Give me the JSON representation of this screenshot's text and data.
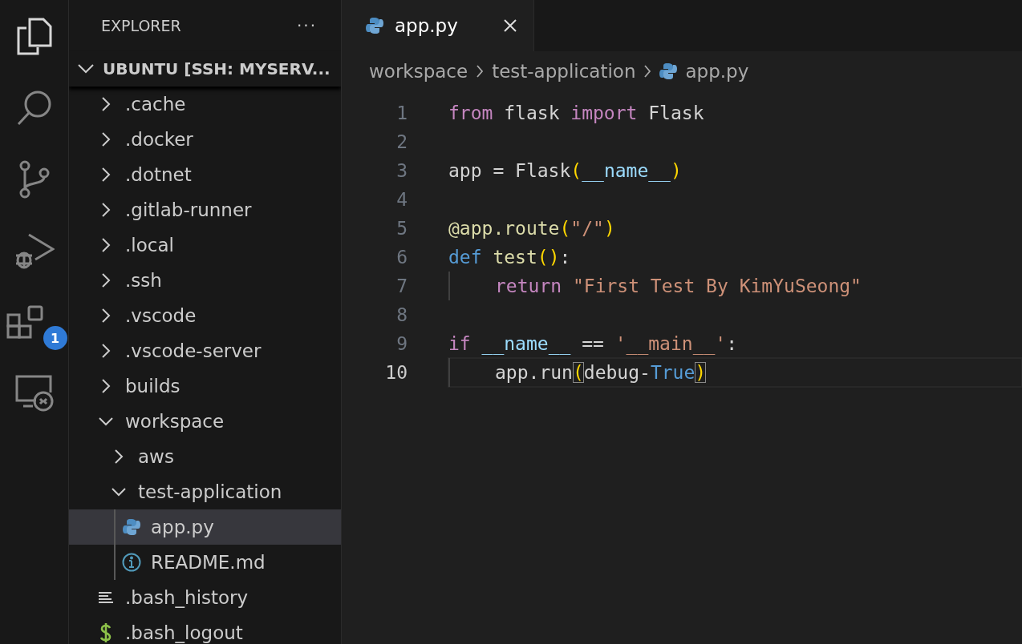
{
  "activity_bar": [
    {
      "kind": "files",
      "selected": true
    },
    {
      "kind": "search",
      "selected": false
    },
    {
      "kind": "source-control",
      "selected": false
    },
    {
      "kind": "run-debug",
      "selected": false
    },
    {
      "kind": "extensions",
      "selected": false,
      "badge": "1"
    },
    {
      "kind": "remote",
      "selected": false
    }
  ],
  "sidebar": {
    "title": "EXPLORER",
    "actions": "···",
    "root": "UBUNTU [SSH: MYSERV...",
    "items": [
      {
        "label": ".cache",
        "kind": "folder",
        "expanded": false,
        "selected": false
      },
      {
        "label": ".docker",
        "kind": "folder",
        "expanded": false,
        "selected": false
      },
      {
        "label": ".dotnet",
        "kind": "folder",
        "expanded": false,
        "selected": false
      },
      {
        "label": ".gitlab-runner",
        "kind": "folder",
        "expanded": false,
        "selected": false
      },
      {
        "label": ".local",
        "kind": "folder",
        "expanded": false,
        "selected": false
      },
      {
        "label": ".ssh",
        "kind": "folder",
        "expanded": false,
        "selected": false
      },
      {
        "label": ".vscode",
        "kind": "folder",
        "expanded": false,
        "selected": false
      },
      {
        "label": ".vscode-server",
        "kind": "folder",
        "expanded": false,
        "selected": false
      },
      {
        "label": "builds",
        "kind": "folder",
        "expanded": false,
        "selected": false
      },
      {
        "label": "workspace",
        "kind": "folder",
        "expanded": true,
        "selected": false,
        "children": [
          {
            "label": "aws",
            "kind": "folder",
            "expanded": false,
            "selected": false
          },
          {
            "label": "test-application",
            "kind": "folder",
            "expanded": true,
            "selected": false,
            "children": [
              {
                "label": "app.py",
                "kind": "python",
                "selected": true
              },
              {
                "label": "README.md",
                "kind": "info",
                "selected": false
              }
            ]
          }
        ]
      },
      {
        "label": ".bash_history",
        "kind": "text",
        "selected": false
      },
      {
        "label": ".bash_logout",
        "kind": "shell",
        "selected": false
      }
    ]
  },
  "tabs": [
    {
      "label": "app.py",
      "selected": true
    }
  ],
  "breadcrumb": [
    "workspace",
    "test-application",
    "app.py"
  ],
  "editor": {
    "lines": [
      {
        "number": "1",
        "current": false,
        "indented": false,
        "tokens": [
          {
            "t": "from",
            "kind": "kw"
          },
          {
            "t": " flask ",
            "kind": "plain"
          },
          {
            "t": "import",
            "kind": "kw"
          },
          {
            "t": " Flask",
            "kind": "plain"
          }
        ]
      },
      {
        "number": "2",
        "current": false,
        "indented": false
      },
      {
        "number": "3",
        "current": false,
        "indented": false,
        "tokens": [
          {
            "t": "app = Flask",
            "kind": "plain"
          },
          {
            "t": "(",
            "kind": "paren"
          },
          {
            "t": "__name__",
            "kind": "var"
          },
          {
            "t": ")",
            "kind": "paren"
          }
        ]
      },
      {
        "number": "4",
        "current": false,
        "indented": false
      },
      {
        "number": "5",
        "current": false,
        "indented": false,
        "tokens": [
          {
            "t": "@app.route",
            "kind": "fn"
          },
          {
            "t": "(",
            "kind": "paren"
          },
          {
            "t": "\"/\"",
            "kind": "str"
          },
          {
            "t": ")",
            "kind": "paren"
          }
        ]
      },
      {
        "number": "6",
        "current": false,
        "indented": false,
        "tokens": [
          {
            "t": "def ",
            "kind": "const"
          },
          {
            "t": "test",
            "kind": "fn"
          },
          {
            "t": "()",
            "kind": "paren"
          },
          {
            "t": ":",
            "kind": "plain"
          }
        ]
      },
      {
        "number": "7",
        "current": false,
        "indented": true,
        "tokens": [
          {
            "t": "return ",
            "kind": "kw"
          },
          {
            "t": "\"First Test By KimYuSeong\"",
            "kind": "str"
          }
        ]
      },
      {
        "number": "8",
        "current": false,
        "indented": false
      },
      {
        "number": "9",
        "current": false,
        "indented": false,
        "tokens": [
          {
            "t": "if ",
            "kind": "kw"
          },
          {
            "t": "__name__",
            "kind": "var"
          },
          {
            "t": " == ",
            "kind": "plain"
          },
          {
            "t": "'__main__'",
            "kind": "str"
          },
          {
            "t": ":",
            "kind": "plain"
          }
        ]
      },
      {
        "number": "10",
        "current": true,
        "indented": true,
        "tokens": [
          {
            "t": "app.run",
            "kind": "plain"
          },
          {
            "t": "(",
            "kind": "match"
          },
          {
            "t": "debug-",
            "kind": "plain"
          },
          {
            "t": "True",
            "kind": "const"
          },
          {
            "t": ")",
            "kind": "match"
          }
        ]
      }
    ]
  }
}
